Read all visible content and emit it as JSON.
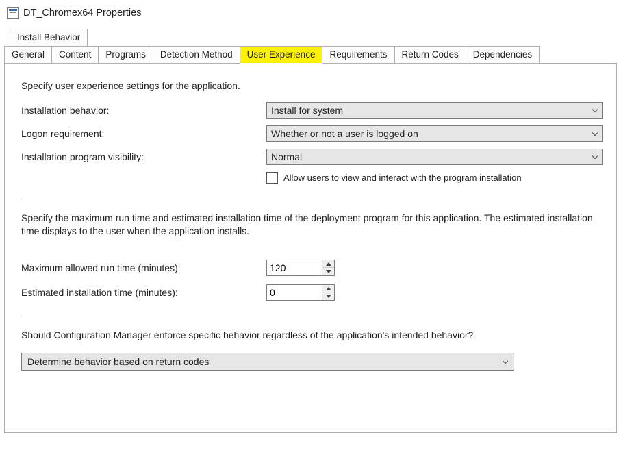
{
  "window": {
    "title": "DT_Chromex64 Properties"
  },
  "tabs": {
    "row1": [
      "Install Behavior"
    ],
    "row2": [
      "General",
      "Content",
      "Programs",
      "Detection Method",
      "User Experience",
      "Requirements",
      "Return Codes",
      "Dependencies"
    ],
    "active": "User Experience"
  },
  "ux": {
    "intro": "Specify user experience settings for the application.",
    "installation_behavior_label": "Installation behavior:",
    "installation_behavior_value": "Install for system",
    "logon_requirement_label": "Logon requirement:",
    "logon_requirement_value": "Whether or not a user is logged on",
    "program_visibility_label": "Installation program visibility:",
    "program_visibility_value": "Normal",
    "allow_interact_label": "Allow users to view and interact with the program installation",
    "allow_interact_checked": false,
    "runtime_intro": "Specify the maximum run time and estimated installation time of the deployment program for this application. The estimated installation time displays to the user when the application installs.",
    "max_runtime_label": "Maximum allowed run time (minutes):",
    "max_runtime_value": "120",
    "est_install_label": "Estimated installation time (minutes):",
    "est_install_value": "0",
    "enforce_question": "Should Configuration Manager enforce specific behavior regardless of the application's intended behavior?",
    "enforce_value": "Determine behavior based on return codes"
  }
}
